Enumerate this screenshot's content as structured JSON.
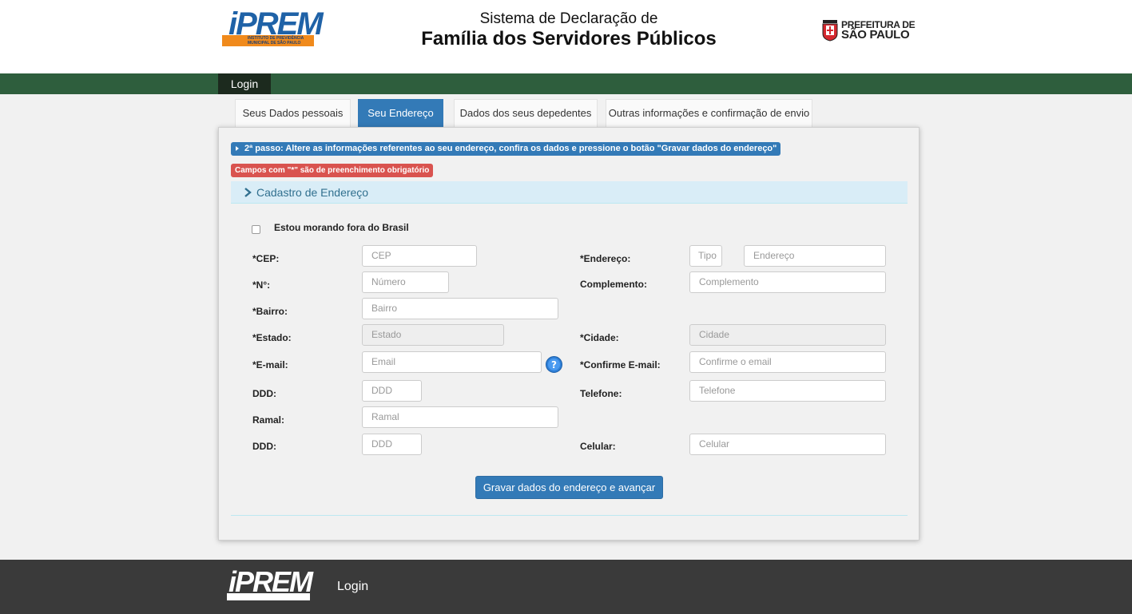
{
  "header": {
    "iprem_logo_text": "iPREM",
    "iprem_logo_subtext": "INSTITUTO DE PREVIDÊNCIA MUNICIPAL DE SÃO PAULO",
    "title_line1": "Sistema de Declaração de",
    "title_line2": "Família dos Servidores Públicos",
    "sp_logo_line1": "PREFEITURA DE",
    "sp_logo_line2": "SÃO PAULO"
  },
  "navbar": {
    "login": "Login"
  },
  "tabs": [
    {
      "label": "Seus Dados pessoais",
      "active": false
    },
    {
      "label": "Seu Endereço",
      "active": true
    },
    {
      "label": "Dados dos seus depedentes",
      "active": false
    },
    {
      "label": "Outras informações e confirmação de envio",
      "active": false
    }
  ],
  "panel": {
    "step_info": "2ª passo: Altere as informações referentes ao seu endereço, confira os dados e pressione o botão \"Gravar dados do endereço\"",
    "required_info": "Campos com \"*\" são de preenchimento obrigatório",
    "section_title": "Cadastro de Endereço",
    "abroad_checkbox_label": "Estou morando fora do Brasil",
    "abroad_checked": false
  },
  "form": {
    "cep": {
      "label": "*CEP:",
      "placeholder": "CEP",
      "value": ""
    },
    "endereco": {
      "label": "*Endereço:",
      "tipo_placeholder": "Tipo",
      "placeholder": "Endereço",
      "value": ""
    },
    "numero": {
      "label": "*N°:",
      "placeholder": "Número",
      "value": ""
    },
    "complemento": {
      "label": "Complemento:",
      "placeholder": "Complemento",
      "value": ""
    },
    "bairro": {
      "label": "*Bairro:",
      "placeholder": "Bairro",
      "value": ""
    },
    "estado": {
      "label": "*Estado:",
      "placeholder": "Estado",
      "value": ""
    },
    "cidade": {
      "label": "*Cidade:",
      "placeholder": "Cidade",
      "value": ""
    },
    "email": {
      "label": "*E-mail:",
      "placeholder": "Email",
      "value": ""
    },
    "confirm_email": {
      "label": "*Confirme E-mail:",
      "placeholder": "Confirme o email",
      "value": ""
    },
    "ddd_tel": {
      "label": "DDD:",
      "placeholder": "DDD",
      "value": ""
    },
    "telefone": {
      "label": "Telefone:",
      "placeholder": "Telefone",
      "value": ""
    },
    "ramal": {
      "label": "Ramal:",
      "placeholder": "Ramal",
      "value": ""
    },
    "ddd_cel": {
      "label": "DDD:",
      "placeholder": "DDD",
      "value": ""
    },
    "celular": {
      "label": "Celular:",
      "placeholder": "Celular",
      "value": ""
    },
    "submit_label": "Gravar dados do endereço e avançar"
  },
  "footer": {
    "logo_text": "iPREM",
    "login": "Login"
  },
  "colors": {
    "navbar": "#2e5e3d",
    "primary": "#337ab7",
    "danger": "#d9534f",
    "footer": "#3a3a3a",
    "iprem_blue": "#1f62a7",
    "iprem_orange": "#f08a1c"
  },
  "icons": [
    "chevron-right-icon",
    "caret-right-icon",
    "help-icon",
    "sp-crest-icon"
  ]
}
